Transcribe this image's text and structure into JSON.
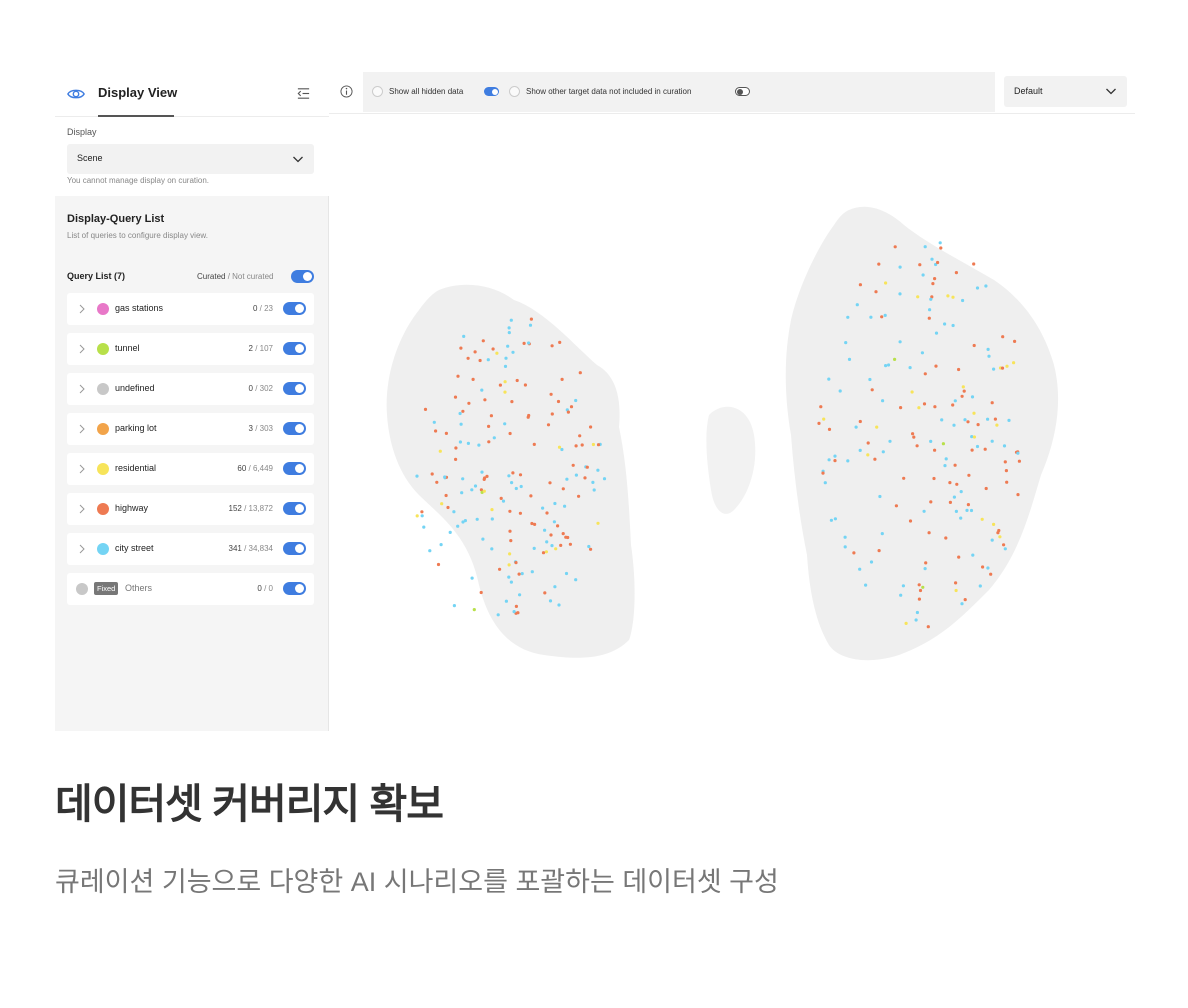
{
  "sidebar": {
    "title": "Display View",
    "display_label": "Display",
    "display_value": "Scene",
    "display_help": "You cannot manage display on curation.",
    "dq_title": "Display-Query List",
    "dq_subtitle": "List of queries to configure display view.",
    "query_list_title": "Query List (7)",
    "curated_label": "Curated",
    "not_curated_label": " / Not curated",
    "queries": [
      {
        "name": "gas stations",
        "count": "0",
        "total": "23",
        "color": "#e878c8",
        "enabled": true
      },
      {
        "name": "tunnel",
        "count": "2",
        "total": "107",
        "color": "#b8e04a",
        "enabled": true
      },
      {
        "name": "undefined",
        "count": "0",
        "total": "302",
        "color": "#c8c8c8",
        "enabled": true
      },
      {
        "name": "parking lot",
        "count": "3",
        "total": "303",
        "color": "#f2a44a",
        "enabled": true
      },
      {
        "name": "residential",
        "count": "60",
        "total": "6,449",
        "color": "#f7e45a",
        "enabled": true
      },
      {
        "name": "highway",
        "count": "152",
        "total": "13,872",
        "color": "#ee7a52",
        "enabled": true
      },
      {
        "name": "city street",
        "count": "341",
        "total": "34,834",
        "color": "#74d4f4",
        "enabled": true
      }
    ],
    "others": {
      "badge": "Fixed",
      "name": "Others",
      "count": "0",
      "total": "0",
      "color": "#c8c8c8",
      "enabled": true
    }
  },
  "toolbar": {
    "show_hidden_label": "Show all hidden data",
    "show_hidden_on": true,
    "show_other_label": "Show other target data not included in curation",
    "show_other_on": false,
    "view_select_value": "Default"
  },
  "embedding_map": {
    "background_color": "#eeeeee",
    "clusters": 2,
    "highlight_colors": [
      "#ee7a52",
      "#74d4f4",
      "#f7e45a",
      "#b8e04a"
    ]
  },
  "caption": {
    "title": "데이터셋 커버리지 확보",
    "subtitle": "큐레이션 기능으로 다양한 AI 시나리오를 포괄하는 데이터셋 구성"
  }
}
